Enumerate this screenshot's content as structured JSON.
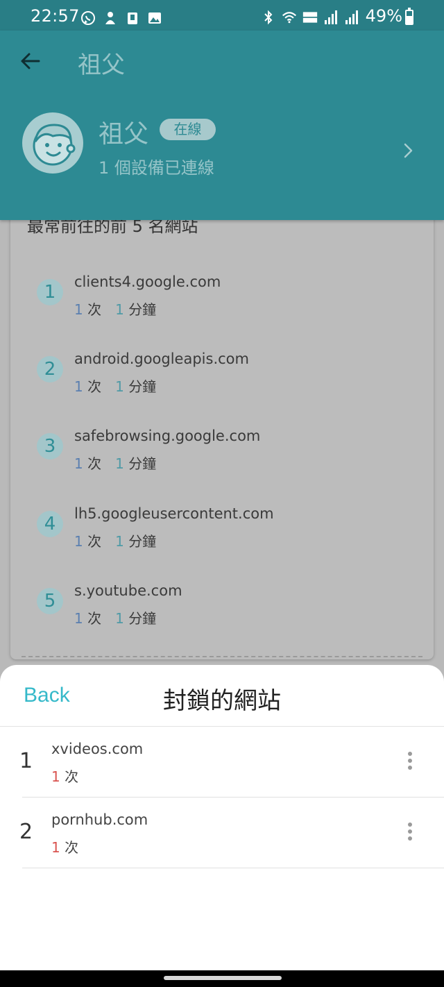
{
  "status_bar": {
    "time": "22:57",
    "battery": "49%",
    "left_icons": [
      "whatsapp-icon",
      "notification-icon",
      "clipboard-icon",
      "image-icon"
    ],
    "right_icons": [
      "bluetooth-icon",
      "wifi-icon",
      "volte-icon",
      "signal-icon",
      "signal-roaming-icon"
    ]
  },
  "header": {
    "title": "祖父",
    "profile": {
      "name": "祖父",
      "status_badge": "在線",
      "subtitle": "1 個設備已連線"
    }
  },
  "card": {
    "heading": "最常前往的前 5 名網站",
    "sites": [
      {
        "rank": "1",
        "domain": "clients4.google.com",
        "visits": "1",
        "visits_unit": "次",
        "minutes": "1",
        "minutes_unit": "分鐘"
      },
      {
        "rank": "2",
        "domain": "android.googleapis.com",
        "visits": "1",
        "visits_unit": "次",
        "minutes": "1",
        "minutes_unit": "分鐘"
      },
      {
        "rank": "3",
        "domain": "safebrowsing.google.com",
        "visits": "1",
        "visits_unit": "次",
        "minutes": "1",
        "minutes_unit": "分鐘"
      },
      {
        "rank": "4",
        "domain": "lh5.googleusercontent.com",
        "visits": "1",
        "visits_unit": "次",
        "minutes": "1",
        "minutes_unit": "分鐘"
      },
      {
        "rank": "5",
        "domain": "s.youtube.com",
        "visits": "1",
        "visits_unit": "次",
        "minutes": "1",
        "minutes_unit": "分鐘"
      }
    ]
  },
  "sheet": {
    "back_label": "Back",
    "title": "封鎖的網站",
    "blocked": [
      {
        "index": "1",
        "domain": "xvideos.com",
        "count": "1",
        "count_unit": "次"
      },
      {
        "index": "2",
        "domain": "pornhub.com",
        "count": "1",
        "count_unit": "次"
      }
    ]
  },
  "colors": {
    "header_bg": "#2d8a93",
    "status_bar_bg": "#297e86",
    "accent_back": "#35b9c9",
    "blocked_count": "#d9534f"
  }
}
